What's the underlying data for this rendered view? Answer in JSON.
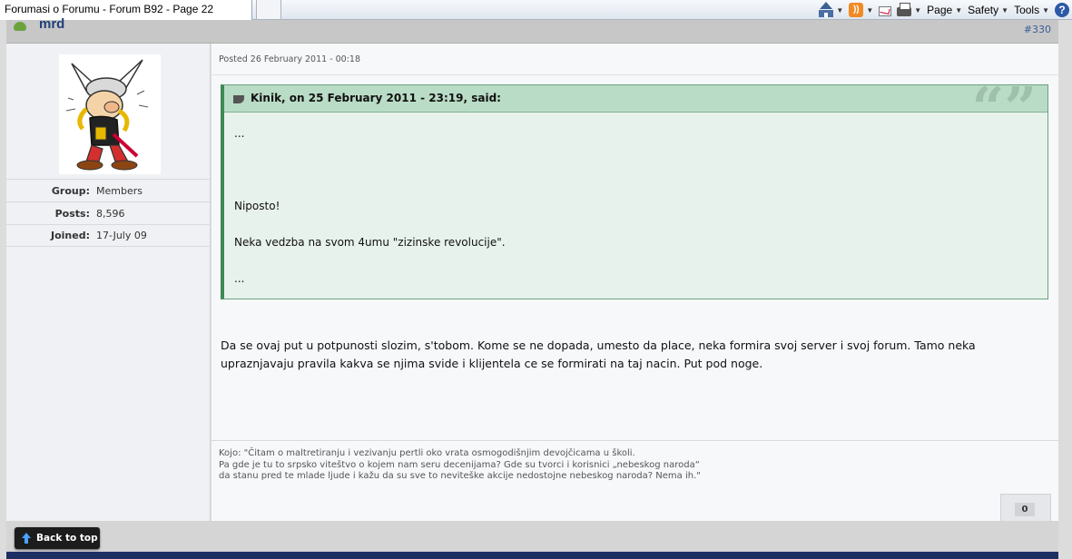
{
  "browser": {
    "tab_title": "Forumasi o Forumu - Forum B92 - Page 22",
    "toolbar": {
      "home_icon": "home-icon",
      "feeds_icon": "rss-icon",
      "mail_icon": "mail-icon",
      "print_icon": "print-icon",
      "page_label": "Page",
      "safety_label": "Safety",
      "tools_label": "Tools",
      "help_label": "?"
    }
  },
  "post": {
    "author": "mrd",
    "number": "#330",
    "posted": "Posted 26 February 2011 - 00:18",
    "quote": {
      "citation": "Kinik, on 25 February 2011 - 23:19, said:",
      "marks": "“”",
      "lines": [
        "...",
        "Niposto!",
        "Neka vedzba na svom 4umu \"zizinske revolucije\".",
        "..."
      ]
    },
    "text": "Da se ovaj put u potpunosti slozim, s'tobom. Kome se ne dopada, umesto da place, neka formira svoj server i svoj forum. Tamo neka upraznjavaju pravila kakva se njima svide i klijentela ce se formirati na taj nacin. Put pod noge.",
    "signature": [
      "Kojo: \"Čitam o maltretiranju i vezivanju pertli oko vrata osmogodišnjim devojčicama u školi.",
      "Pa gde je tu to srpsko viteštvo o kojem nam seru decenijama? Gde su tvorci i korisnici „nebeskog naroda“",
      "da stanu pred te mlade ljude i kažu da su sve to neviteške akcije nedostojne nebeskog naroda? Nema ih.\""
    ],
    "reputation": "0"
  },
  "author_panel": {
    "info": [
      {
        "label": "Group:",
        "value": "Members"
      },
      {
        "label": "Posts:",
        "value": "8,596"
      },
      {
        "label": "Joined:",
        "value": "17-July 09"
      }
    ]
  },
  "footer": {
    "back_to_top": "Back to top"
  }
}
